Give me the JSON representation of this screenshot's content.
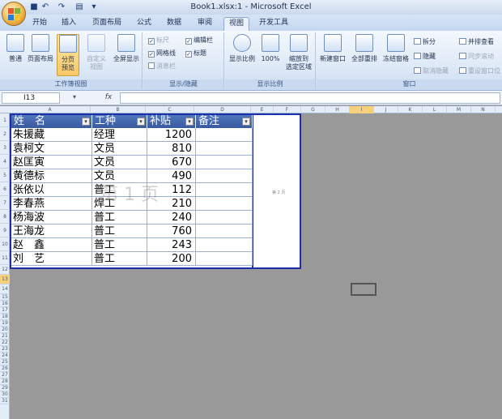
{
  "window": {
    "title": "Book1.xlsx:1 - Microsoft Excel"
  },
  "quick_access": {
    "icons": [
      "save-icon",
      "undo-icon",
      "redo-icon",
      "print-preview-icon",
      "customize-icon"
    ]
  },
  "tabs": [
    {
      "label": "开始",
      "active": false
    },
    {
      "label": "插入",
      "active": false
    },
    {
      "label": "页面布局",
      "active": false
    },
    {
      "label": "公式",
      "active": false
    },
    {
      "label": "数据",
      "active": false
    },
    {
      "label": "审阅",
      "active": false
    },
    {
      "label": "视图",
      "active": true
    },
    {
      "label": "开发工具",
      "active": false
    }
  ],
  "ribbon": {
    "workbook_views": {
      "label": "工作簿视图",
      "buttons": [
        {
          "label": "普通"
        },
        {
          "label": "页面布局"
        },
        {
          "label": "分页\n预览"
        },
        {
          "label": "自定义\n视图"
        },
        {
          "label": "全屏显示"
        }
      ]
    },
    "show_hide": {
      "label": "显示/隐藏",
      "checks": [
        {
          "label": "标尺",
          "checked": true,
          "disabled": true
        },
        {
          "label": "编辑栏",
          "checked": true,
          "disabled": false
        },
        {
          "label": "网格线",
          "checked": true,
          "disabled": false
        },
        {
          "label": "标题",
          "checked": true,
          "disabled": false
        },
        {
          "label": "消息栏",
          "checked": false,
          "disabled": true
        }
      ]
    },
    "zoom": {
      "label": "显示比例",
      "buttons": [
        {
          "label": "显示比例"
        },
        {
          "label": "100%"
        },
        {
          "label": "缩放到\n选定区域"
        }
      ]
    },
    "window_group": {
      "label": "窗口",
      "buttons": [
        {
          "label": "新建窗口"
        },
        {
          "label": "全部重排"
        },
        {
          "label": "冻结窗格"
        }
      ],
      "small": [
        {
          "label": "拆分",
          "disabled": false
        },
        {
          "label": "隐藏",
          "disabled": false
        },
        {
          "label": "取消隐藏",
          "disabled": true
        },
        {
          "label": "并排查看",
          "disabled": false
        },
        {
          "label": "同步滚动",
          "disabled": true
        },
        {
          "label": "重设窗口位",
          "disabled": true
        }
      ]
    }
  },
  "formula_bar": {
    "name_box": "I13",
    "fx": "fx",
    "value": ""
  },
  "grid": {
    "columns": [
      "A",
      "B",
      "C",
      "D",
      "E",
      "F",
      "G",
      "H",
      "I",
      "J",
      "K",
      "L",
      "M",
      "N"
    ],
    "selected_column": "I",
    "rows": [
      "1",
      "2",
      "3",
      "4",
      "5",
      "6",
      "7",
      "8",
      "9",
      "10",
      "11",
      "12",
      "13",
      "14",
      "15",
      "16",
      "17",
      "18",
      "19",
      "20",
      "21",
      "22",
      "23",
      "24",
      "25",
      "26",
      "27",
      "28",
      "29",
      "30",
      "31"
    ],
    "selected_row": "13"
  },
  "table": {
    "headers": [
      "姓　名",
      "工种",
      "补贴",
      "备注"
    ],
    "rows": [
      {
        "name": "朱援藏",
        "type": "经理",
        "amount": "1200",
        "note": ""
      },
      {
        "name": "袁柯文",
        "type": "文员",
        "amount": "810",
        "note": ""
      },
      {
        "name": "赵匡寅",
        "type": "文员",
        "amount": "670",
        "note": ""
      },
      {
        "name": "黄德标",
        "type": "文员",
        "amount": "490",
        "note": ""
      },
      {
        "name": "张依以",
        "type": "普工",
        "amount": "112",
        "note": ""
      },
      {
        "name": "李春燕",
        "type": "焊工",
        "amount": "210",
        "note": ""
      },
      {
        "name": "杨海波",
        "type": "普工",
        "amount": "240",
        "note": ""
      },
      {
        "name": "王海龙",
        "type": "普工",
        "amount": "760",
        "note": ""
      },
      {
        "name": "赵　鑫",
        "type": "普工",
        "amount": "243",
        "note": ""
      },
      {
        "name": "刘　艺",
        "type": "普工",
        "amount": "200",
        "note": ""
      }
    ]
  },
  "page_watermark": "第 1 页",
  "page2_label": "第 2 页"
}
